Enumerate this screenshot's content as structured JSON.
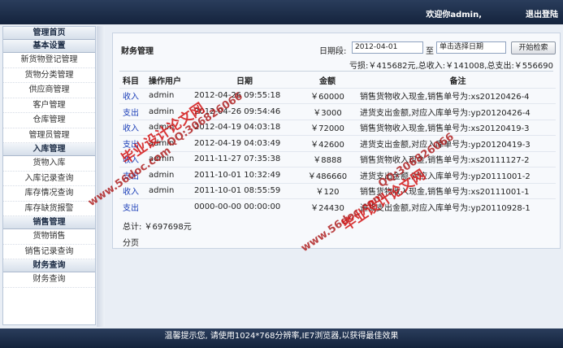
{
  "header": {
    "welcome": "欢迎你admin,",
    "logout": "退出登陆"
  },
  "sidebar": {
    "home": "管理首页",
    "groups": [
      {
        "title": "基本设置",
        "items": [
          "新货物登记管理",
          "货物分类管理",
          "供应商管理",
          "客户管理",
          "仓库管理",
          "管理员管理"
        ]
      },
      {
        "title": "入库管理",
        "items": [
          "货物入库",
          "入库记录查询",
          "库存情况查询",
          "库存缺货报警"
        ]
      },
      {
        "title": "销售管理",
        "items": [
          "货物销售",
          "销售记录查询"
        ]
      },
      {
        "title": "财务查询",
        "items": [
          "财务查询"
        ]
      }
    ]
  },
  "panel": {
    "title": "财务管理",
    "date_label": "日期段:",
    "date_from": "2012-04-01",
    "to_label": "至",
    "date_to": "单击选择日期",
    "search_button": "开始检索",
    "summary": "亏损:￥415682元,总收入:￥141008,总支出:￥556690",
    "columns": [
      "科目",
      "操作用户",
      "日期",
      "金额",
      "备注"
    ],
    "rows": [
      {
        "type": "收入",
        "user": "admin",
        "date": "2012-04-26 09:55:18",
        "amount": "￥60000",
        "note": "销售货物收入现金,销售单号为:xs20120426-4"
      },
      {
        "type": "支出",
        "user": "admin",
        "date": "2012-04-26 09:54:46",
        "amount": "￥3000",
        "note": "进货支出金额,对应入库单号为:yp20120426-4"
      },
      {
        "type": "收入",
        "user": "admin",
        "date": "2012-04-19 04:03:18",
        "amount": "￥72000",
        "note": "销售货物收入现金,销售单号为:xs20120419-3"
      },
      {
        "type": "支出",
        "user": "admin",
        "date": "2012-04-19 04:03:49",
        "amount": "￥42600",
        "note": "进货支出金额,对应入库单号为:yp20120419-3"
      },
      {
        "type": "收入",
        "user": "admin",
        "date": "2011-11-27 07:35:38",
        "amount": "￥8888",
        "note": "销售货物收入现金,销售单号为:xs20111127-2"
      },
      {
        "type": "支出",
        "user": "admin",
        "date": "2011-10-01 10:32:49",
        "amount": "￥486660",
        "note": "进货支出金额,对应入库单号为:yp20111001-2"
      },
      {
        "type": "收入",
        "user": "admin",
        "date": "2011-10-01 08:55:59",
        "amount": "￥120",
        "note": "销售货物收入现金,销售单号为:xs20111001-1"
      },
      {
        "type": "支出",
        "user": "",
        "date": "0000-00-00 00:00:00",
        "amount": "￥24430",
        "note": "进货支出金额,对应入库单号为:yp20110928-1"
      }
    ],
    "total": "总计: ￥697698元",
    "pager": "分页"
  },
  "watermarks": {
    "site": "www.56doc.com",
    "qq": "QQ:306826066",
    "brand": "毕业设计论文网"
  },
  "footer": {
    "tip": "温馨提示您,    请使用1024*768分辨率,IE7浏览器,以获得最佳效果"
  }
}
